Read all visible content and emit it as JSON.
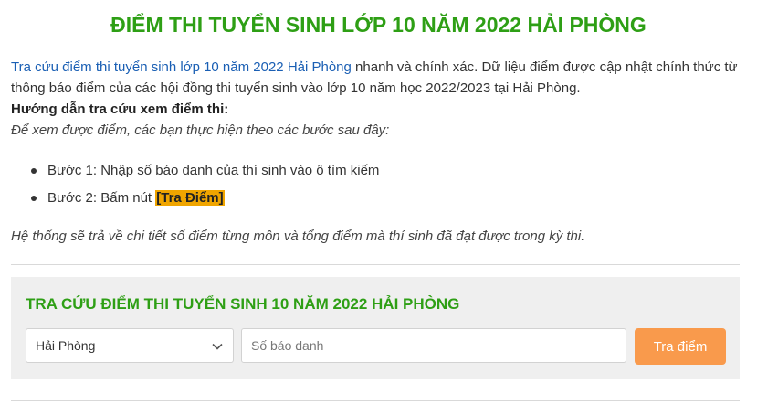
{
  "page": {
    "title": "ĐIỂM THI TUYỂN SINH LỚP 10 NĂM 2022 HẢI PHÒNG"
  },
  "intro": {
    "link_text": "Tra cứu điểm thi tuyển sinh lớp 10 năm 2022 Hải Phòng",
    "text": " nhanh và chính xác. Dữ liệu điểm được cập nhật chính thức từ thông báo điểm của các hội đồng thi tuyển sinh vào lớp 10 năm học 2022/2023 tại Hải Phòng."
  },
  "guide": {
    "heading": "Hướng dẫn tra cứu xem điểm thi:",
    "subheading": "Để xem được điểm, các bạn thực hiện theo các bước sau đây:",
    "step1": "Bước 1: Nhập số báo danh của thí sinh vào ô tìm kiếm",
    "step2_prefix": "Bước 2: Bấm nút ",
    "step2_highlight": "[Tra Điểm]",
    "note": "Hệ thống sẽ trả về chi tiết số điểm từng môn và tổng điểm mà thí sinh đã đạt được trong kỳ thi."
  },
  "search": {
    "title": "TRA CỨU ĐIỂM THI TUYỂN SINH 10 NĂM 2022 HẢI PHÒNG",
    "select_value": "Hải Phòng",
    "input_placeholder": "Số báo danh",
    "input_value": "",
    "button_label": "Tra điểm"
  },
  "colors": {
    "title_green": "#2e9f15",
    "link_blue": "#1a5fb4",
    "highlight": "#f0a500",
    "button": "#f99a4c",
    "panel_bg": "#efefef"
  },
  "icons": {
    "select_arrow": "chevron-down-icon",
    "bullet": "bullet-dot-icon"
  }
}
